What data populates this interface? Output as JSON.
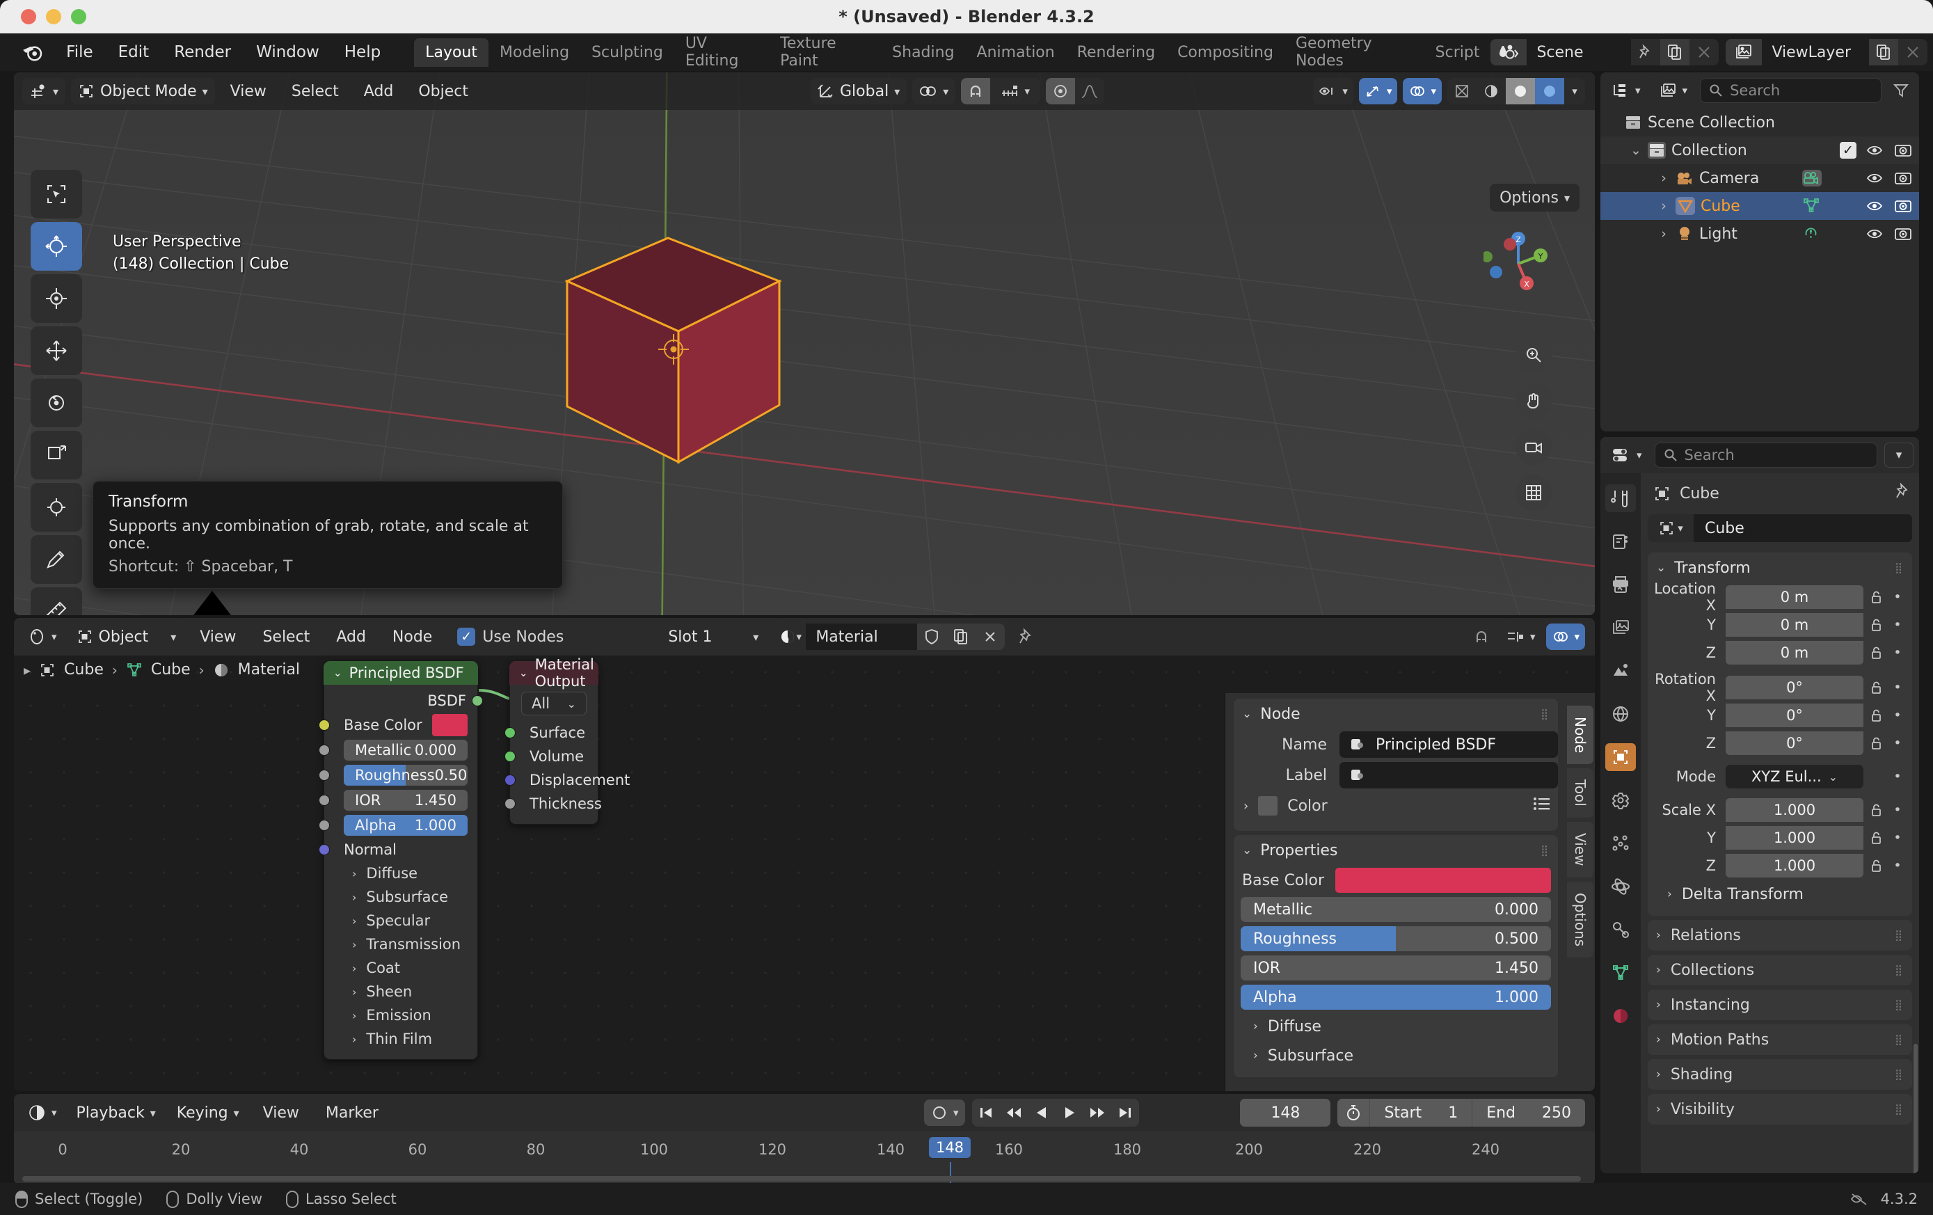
{
  "window": {
    "title": "* (Unsaved) - Blender 4.3.2"
  },
  "topbar": {
    "menus": [
      "File",
      "Edit",
      "Render",
      "Window",
      "Help"
    ],
    "workspaces": [
      "Layout",
      "Modeling",
      "Sculpting",
      "UV Editing",
      "Texture Paint",
      "Shading",
      "Animation",
      "Rendering",
      "Compositing",
      "Geometry Nodes",
      "Script"
    ],
    "active_workspace": "Layout",
    "scene_name": "Scene",
    "viewlayer_name": "ViewLayer"
  },
  "viewport": {
    "mode": "Object Mode",
    "menus": [
      "View",
      "Select",
      "Add",
      "Object"
    ],
    "transform_orientation": "Global",
    "options_label": "Options",
    "overlay_line1": "User Perspective",
    "overlay_line2": "(148) Collection | Cube",
    "gizmo_axes": [
      "X",
      "Y",
      "Z"
    ]
  },
  "tooltip": {
    "title": "Transform",
    "description": "Supports any combination of grab, rotate, and scale at once.",
    "shortcut": "Shortcut: ⇧ Spacebar, T"
  },
  "outliner": {
    "search_placeholder": "Search",
    "rows": [
      {
        "label": "Scene Collection",
        "indent": 0,
        "icon": "collection-icon",
        "selected": false,
        "expandable": false
      },
      {
        "label": "Collection",
        "indent": 1,
        "icon": "collection-icon",
        "selected": false,
        "expandable": true
      },
      {
        "label": "Camera",
        "indent": 2,
        "icon": "camera-icon",
        "selected": false,
        "expandable": true
      },
      {
        "label": "Cube",
        "indent": 2,
        "icon": "mesh-icon",
        "selected": true,
        "expandable": true
      },
      {
        "label": "Light",
        "indent": 2,
        "icon": "light-icon",
        "selected": false,
        "expandable": true
      }
    ]
  },
  "properties": {
    "search_placeholder": "Search",
    "breadcrumb_object": "Cube",
    "object_name": "Cube",
    "transform_title": "Transform",
    "fields": [
      {
        "label": "Location X",
        "value": "0 m"
      },
      {
        "label": "Y",
        "value": "0 m"
      },
      {
        "label": "Z",
        "value": "0 m"
      },
      {
        "label": "Rotation X",
        "value": "0°"
      },
      {
        "label": "Y",
        "value": "0°"
      },
      {
        "label": "Z",
        "value": "0°"
      },
      {
        "label": "Mode",
        "value": "XYZ Eul..."
      },
      {
        "label": "Scale X",
        "value": "1.000"
      },
      {
        "label": "Y",
        "value": "1.000"
      },
      {
        "label": "Z",
        "value": "1.000"
      }
    ],
    "delta_transform": "Delta Transform",
    "panels": [
      "Relations",
      "Collections",
      "Instancing",
      "Motion Paths",
      "Shading",
      "Visibility"
    ]
  },
  "shader": {
    "editor_type": "Object",
    "menus": [
      "View",
      "Select",
      "Add",
      "Node"
    ],
    "use_nodes_label": "Use Nodes",
    "slot": "Slot 1",
    "material_name": "Material",
    "breadcrumb": [
      "Cube",
      "Cube",
      "Material"
    ],
    "nodes": {
      "bsdf": {
        "title": "Principled BSDF",
        "header_color": "#356235",
        "output_socket": "BSDF",
        "base_color_label": "Base Color",
        "base_color_value": "#d93355",
        "sliders": [
          {
            "label": "Metallic",
            "value": "0.000",
            "fill": 0
          },
          {
            "label": "Roughness",
            "value": "0.500",
            "fill": 50
          },
          {
            "label": "IOR",
            "value": "1.450",
            "fill": 0
          },
          {
            "label": "Alpha",
            "value": "1.000",
            "fill": 100
          }
        ],
        "normal_label": "Normal",
        "sections": [
          "Diffuse",
          "Subsurface",
          "Specular",
          "Transmission",
          "Coat",
          "Sheen",
          "Emission",
          "Thin Film"
        ]
      },
      "output": {
        "title": "Material Output",
        "header_color": "#472630",
        "target": "All",
        "inputs": [
          {
            "label": "Surface",
            "color": "#65c565"
          },
          {
            "label": "Volume",
            "color": "#65c565"
          },
          {
            "label": "Displacement",
            "color": "#5a5ac8"
          },
          {
            "label": "Thickness",
            "color": "#9b9b9b"
          }
        ]
      }
    },
    "sidebar": {
      "node_panel_title": "Node",
      "name_label": "Name",
      "name_value": "Principled BSDF",
      "label_label": "Label",
      "label_value": "",
      "color_label": "Color",
      "properties_title": "Properties",
      "base_color_label": "Base Color",
      "base_color_value": "#d93355",
      "sliders": [
        {
          "label": "Metallic",
          "value": "0.000",
          "fill": 0
        },
        {
          "label": "Roughness",
          "value": "0.500",
          "fill": 50
        },
        {
          "label": "IOR",
          "value": "1.450",
          "fill": 0
        },
        {
          "label": "Alpha",
          "value": "1.000",
          "fill": 100
        }
      ],
      "sections": [
        "Diffuse",
        "Subsurface"
      ],
      "tabs": [
        "Node",
        "Tool",
        "View",
        "Options"
      ],
      "active_tab": "Node"
    }
  },
  "timeline": {
    "menus": [
      "Playback",
      "Keying",
      "View",
      "Marker"
    ],
    "current_frame": "148",
    "start_label": "Start",
    "start_value": "1",
    "end_label": "End",
    "end_value": "250",
    "ticks": [
      "0",
      "20",
      "40",
      "60",
      "80",
      "100",
      "120",
      "140",
      "160",
      "180",
      "200",
      "220",
      "240"
    ],
    "playhead_label": "148"
  },
  "statusbar": {
    "items": [
      "Select (Toggle)",
      "Dolly View",
      "Lasso Select"
    ],
    "version": "4.3.2"
  }
}
